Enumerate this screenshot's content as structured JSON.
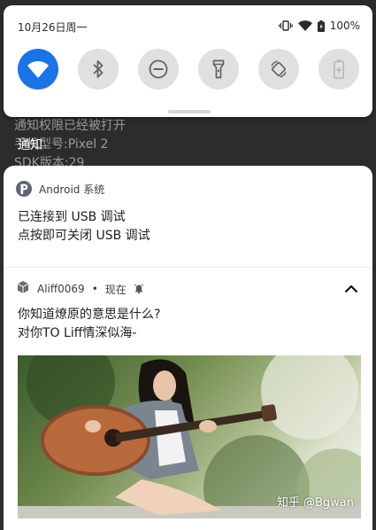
{
  "background_app": {
    "lines": [
      "通知权限已经被打开",
      "手机型号:Pixel 2",
      "SDK版本:29"
    ]
  },
  "status_bar": {
    "date": "10月26日周一",
    "battery_percent": "100%",
    "icons": [
      "vibrate-icon",
      "wifi-icon",
      "battery-charging-icon"
    ]
  },
  "quick_settings": {
    "tiles": [
      {
        "icon": "wifi-icon",
        "active": true
      },
      {
        "icon": "bluetooth-icon",
        "active": false
      },
      {
        "icon": "do-not-disturb-icon",
        "active": false
      },
      {
        "icon": "flashlight-icon",
        "active": false
      },
      {
        "icon": "auto-rotate-icon",
        "active": false
      },
      {
        "icon": "battery-saver-icon",
        "active": false
      }
    ],
    "accent_color": "#1a73e8"
  },
  "section_title": "通知",
  "notifications": [
    {
      "app_name": "Android 系统",
      "title": "已连接到 USB 调试",
      "text": "点按即可关闭 USB 调试"
    },
    {
      "app_name": "Aliff0069",
      "time": "现在",
      "separator": "•",
      "title": "你知道燎原的意思是什么?",
      "text": "对你TO Liff情深似海-",
      "image_watermark": "知乎 @Bgwan"
    }
  ]
}
